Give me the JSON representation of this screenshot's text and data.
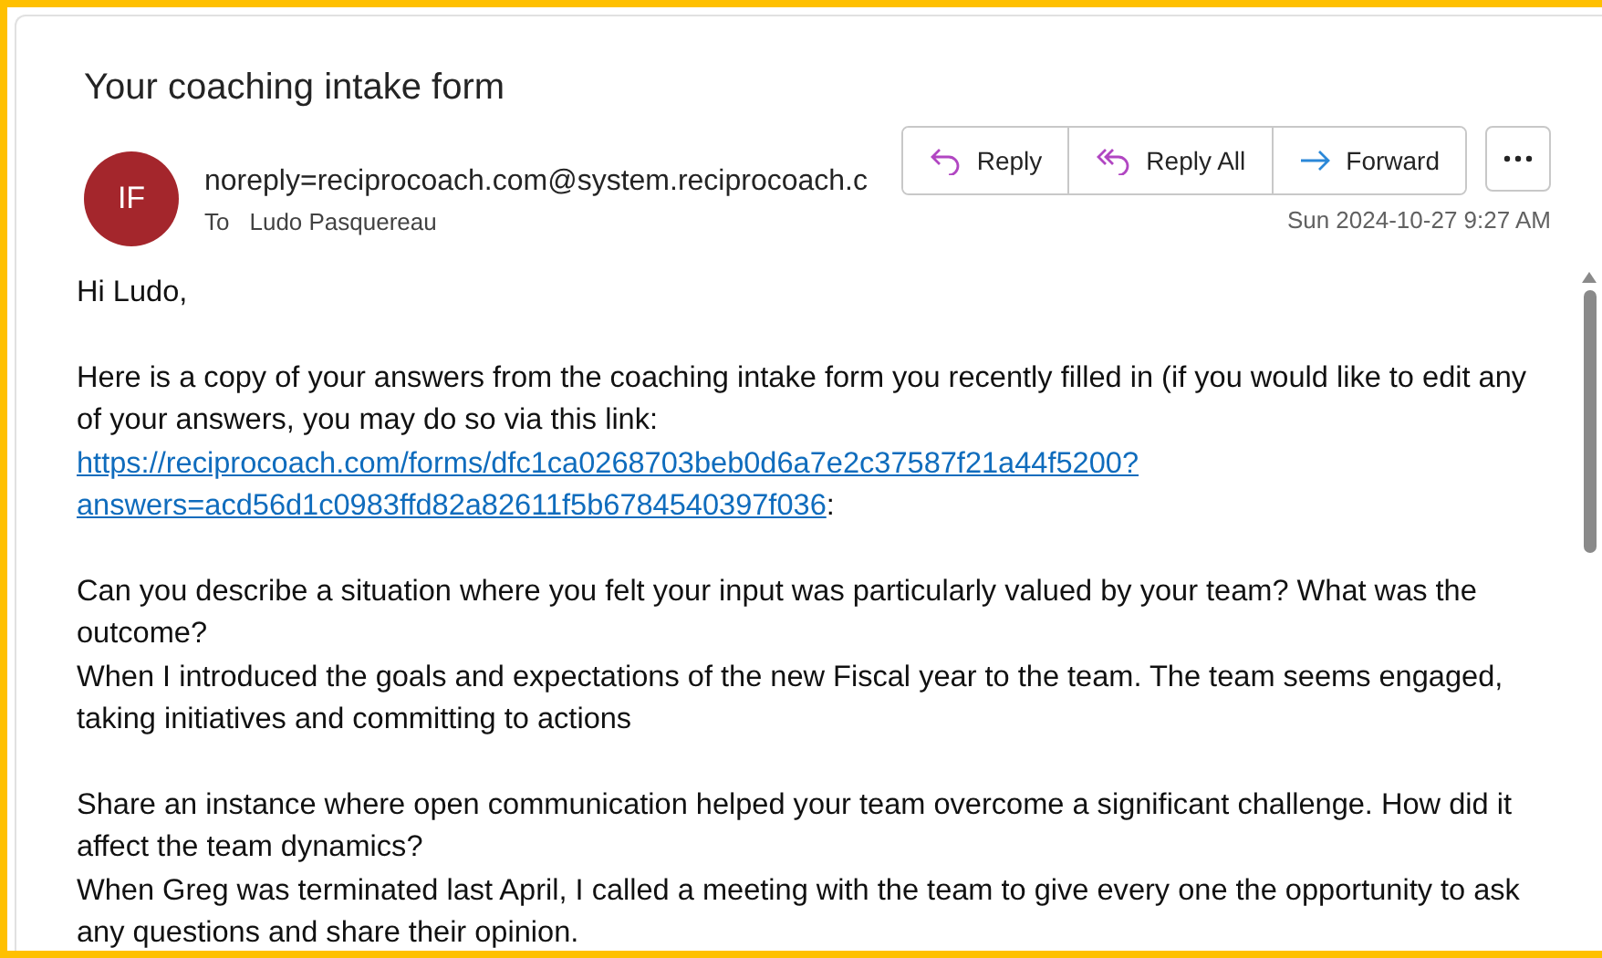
{
  "subject": "Your coaching intake form",
  "sender": {
    "initials": "IF",
    "address": "noreply=reciprocoach.com@system.reciprocoach.c",
    "to_label": "To",
    "to": "Ludo Pasquereau",
    "date": "Sun 2024-10-27 9:27 AM"
  },
  "actions": [
    {
      "kind": "reply",
      "label": "Reply"
    },
    {
      "kind": "reply_all",
      "label": "Reply All"
    },
    {
      "kind": "forward",
      "label": "Forward"
    }
  ],
  "body": [
    {
      "kind": "text",
      "text": "Hi Ludo,"
    },
    {
      "kind": "link",
      "text": "Here is a copy of your answers from the coaching intake form you recently filled in (if you would like to edit any of your answers, you may do so via this link:",
      "link": "https://reciprocoach.com/forms/dfc1ca0268703beb0d6a7e2c37587f21a44f5200?",
      "link2": "answers=acd56d1c0983ffd82a82611f5b6784540397f036",
      "suffix": ":"
    },
    {
      "kind": "qa",
      "question": "Can you describe a situation where you felt your input was particularly valued by your team? What was the outcome?",
      "answer": "When I introduced the goals and expectations of the new Fiscal year to the team. The team seems engaged, taking initiatives and committing to actions"
    },
    {
      "kind": "qa",
      "question": "Share an instance where open communication helped your team overcome a significant challenge. How did it affect the team dynamics?",
      "answer": "When Greg was terminated last April, I called a meeting with the team to give every one the opportunity to ask any questions and share their opinion."
    }
  ]
}
